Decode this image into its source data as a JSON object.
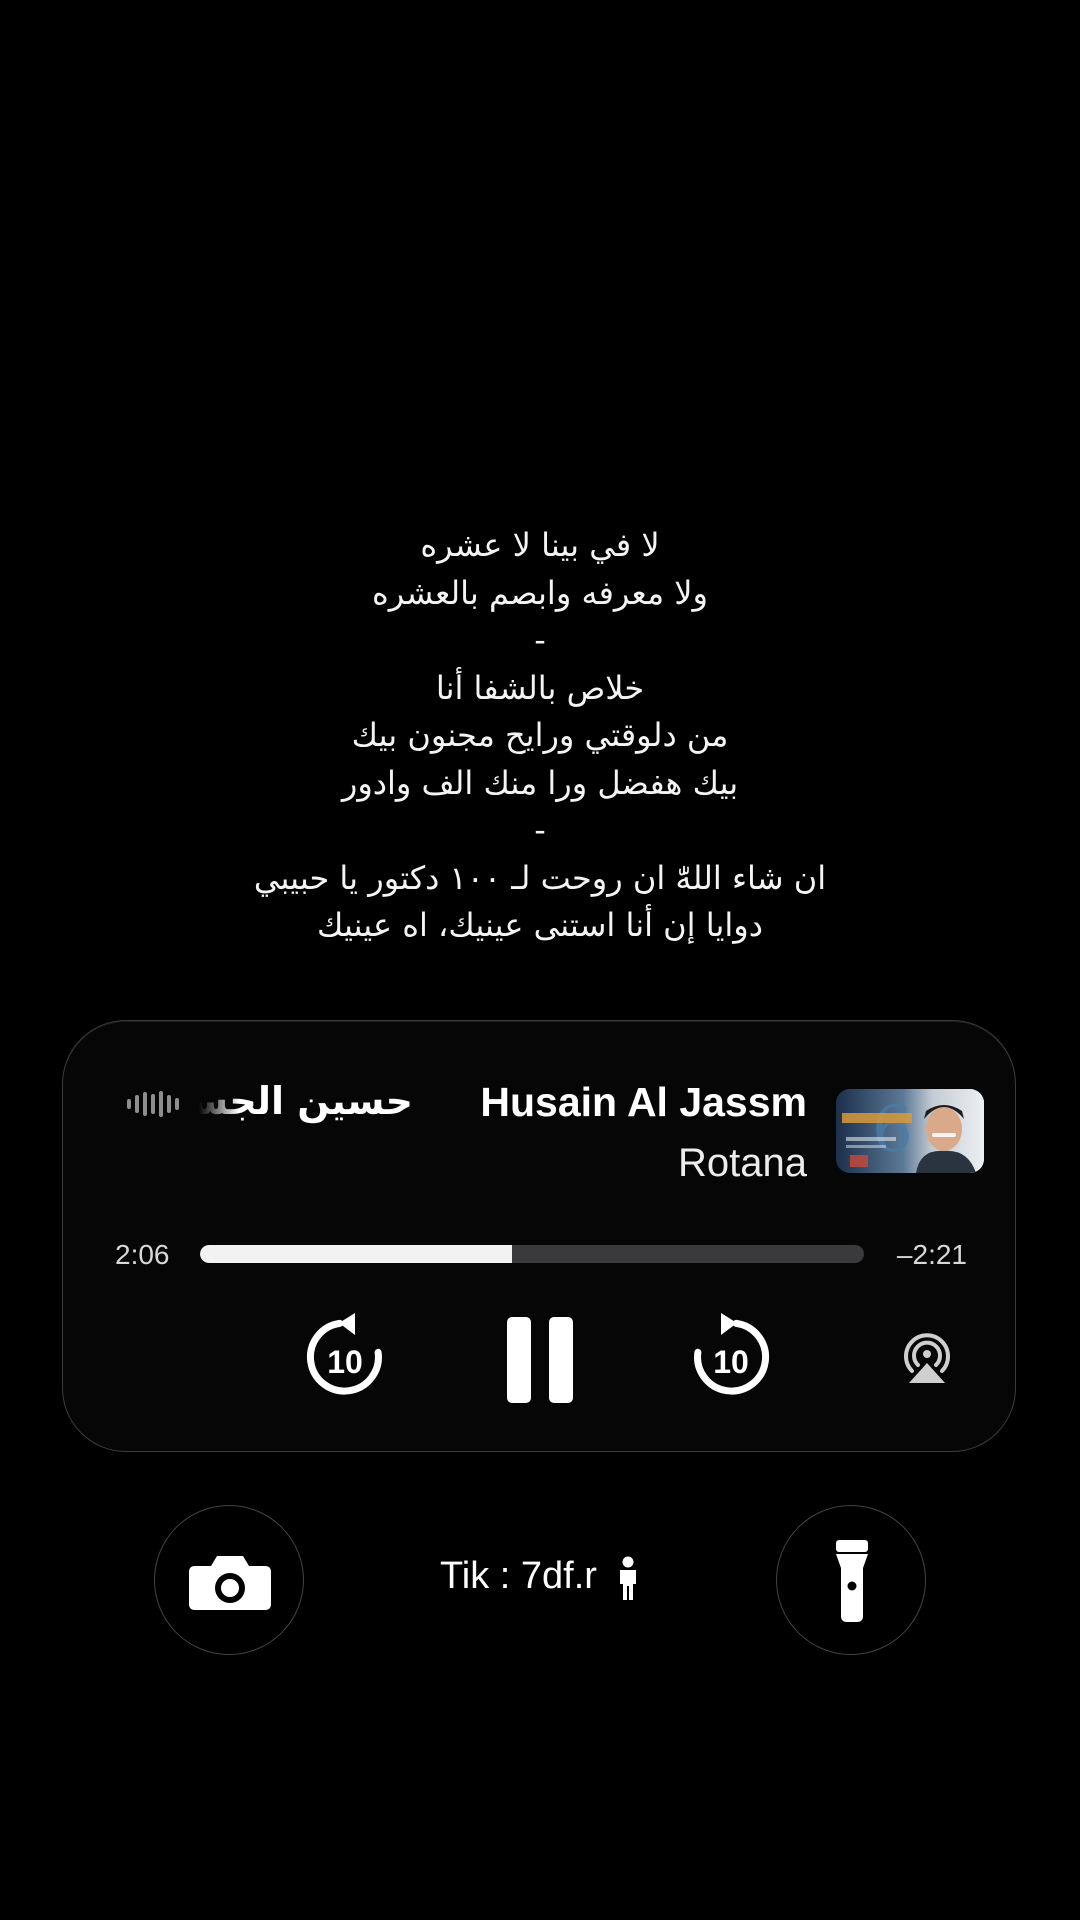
{
  "lyrics": [
    "لا في بينا لا عشره",
    "ولا معرفه وابصم بالعشره",
    "-",
    "خلاص بالشفا أنا",
    "من دلوقتي ورايح مجنون بيك",
    "بيك هفضل ورا منك الف وادور",
    "-",
    "ان شاء اللهّٰ ان روحت لـ ١٠٠ دكتور يا حبيبي",
    "دوايا إن أنا استنى عينيك، اه عينيك"
  ],
  "now_playing": {
    "title": "Husain Al Jassm",
    "subtitle": "Rotana",
    "marquee_text": "حسين الجسمي",
    "elapsed": "2:06",
    "remaining": "–2:21",
    "progress": 0.47,
    "skip_back_seconds": "10",
    "skip_forward_seconds": "10",
    "state": "playing"
  },
  "footer": {
    "credit": "Tik : 7df.r"
  },
  "icons": {
    "audio_wave": "audio-wave-icon",
    "skip_back": "skip-back-10-icon",
    "pause": "pause-icon",
    "skip_forward": "skip-forward-10-icon",
    "airplay": "airplay-icon",
    "camera": "camera-icon",
    "flashlight": "flashlight-icon",
    "person": "person-icon"
  },
  "colors": {
    "background": "#000000",
    "player_bg": "#060606",
    "progress_fill": "#f2f2f2",
    "progress_track": "#3a3a3c"
  }
}
